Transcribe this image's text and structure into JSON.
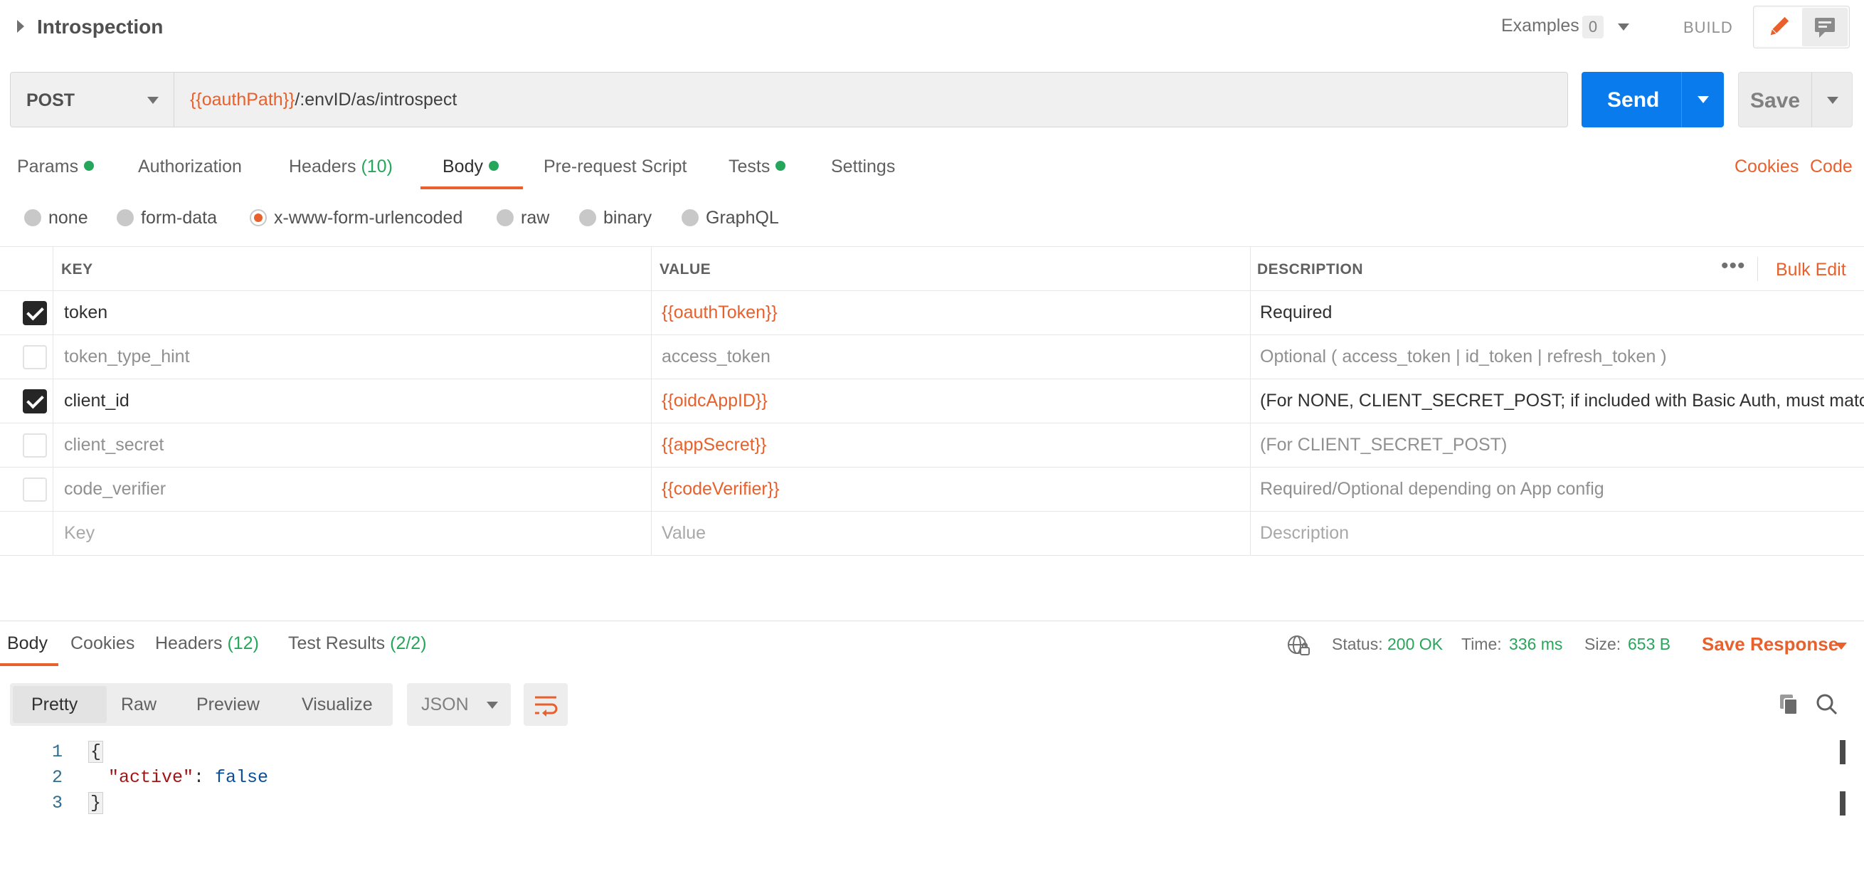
{
  "header": {
    "title": "Introspection",
    "examples_label": "Examples",
    "examples_count": "0",
    "build_label": "BUILD"
  },
  "request": {
    "method": "POST",
    "url_var": "{{oauthPath}}",
    "url_path": "/:envID/as/introspect",
    "send_label": "Send",
    "save_label": "Save"
  },
  "request_tabs": {
    "params": "Params",
    "authorization": "Authorization",
    "headers": "Headers",
    "headers_count": "(10)",
    "body": "Body",
    "prerequest": "Pre-request Script",
    "tests": "Tests",
    "settings": "Settings",
    "cookies": "Cookies",
    "code": "Code"
  },
  "body_types": [
    "none",
    "form-data",
    "x-www-form-urlencoded",
    "raw",
    "binary",
    "GraphQL"
  ],
  "body_type_selected": "x-www-form-urlencoded",
  "table": {
    "headers": {
      "key": "KEY",
      "value": "VALUE",
      "description": "DESCRIPTION"
    },
    "more_label": "•••",
    "bulk_edit": "Bulk Edit",
    "rows": [
      {
        "checked": true,
        "key": "token",
        "value": "{{oauthToken}}",
        "description": "Required"
      },
      {
        "checked": false,
        "key": "token_type_hint",
        "value": "access_token",
        "description": "Optional ( access_token | id_token | refresh_token )"
      },
      {
        "checked": true,
        "key": "client_id",
        "value": "{{oidcAppID}}",
        "description": "(For NONE, CLIENT_SECRET_POST; if included with Basic Auth, must match HTTP Basic Auth client_id)"
      },
      {
        "checked": false,
        "key": "client_secret",
        "value": "{{appSecret}}",
        "description": "(For CLIENT_SECRET_POST)"
      },
      {
        "checked": false,
        "key": "code_verifier",
        "value": "{{codeVerifier}}",
        "description": "Required/Optional depending on App config"
      }
    ],
    "placeholder": {
      "key": "Key",
      "value": "Value",
      "description": "Description"
    }
  },
  "response_tabs": {
    "body": "Body",
    "cookies": "Cookies",
    "headers": "Headers",
    "headers_count": "(12)",
    "test_results": "Test Results",
    "test_results_count": "(2/2)"
  },
  "response_status": {
    "status_label": "Status:",
    "status_value": "200 OK",
    "time_label": "Time:",
    "time_value": "336 ms",
    "size_label": "Size:",
    "size_value": "653 B",
    "save_response": "Save Response"
  },
  "response_toolbar": {
    "views": [
      "Pretty",
      "Raw",
      "Preview",
      "Visualize"
    ],
    "format": "JSON"
  },
  "response_body": {
    "line_numbers": [
      "1",
      "2",
      "3"
    ],
    "open_brace": "{",
    "key": "\"active\"",
    "colon": ": ",
    "value": "false",
    "close_brace": "}"
  },
  "colors": {
    "accent": "#e8602c",
    "send_blue": "#097bed",
    "success_green": "#26a65b"
  },
  "icons": [
    "expand-caret-icon",
    "pencil-icon",
    "comment-icon",
    "globe-icon",
    "wrap-lines-icon",
    "copy-icon",
    "search-icon"
  ]
}
